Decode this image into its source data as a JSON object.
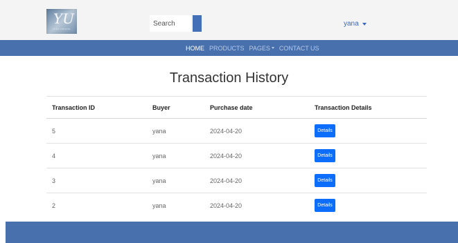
{
  "header": {
    "logo_mark": "YU",
    "logo_subtext": "YANA UNIQUE",
    "search_placeholder": "Search",
    "user_name": "yana"
  },
  "nav": {
    "items": [
      {
        "label": "HOME",
        "active": true
      },
      {
        "label": "PRODUCTS",
        "active": false
      },
      {
        "label": "PAGES",
        "active": false,
        "has_dropdown": true
      },
      {
        "label": "CONTACT US",
        "active": false
      }
    ]
  },
  "page": {
    "title": "Transaction History"
  },
  "table": {
    "headers": [
      "Transaction ID",
      "Buyer",
      "Purchase date",
      "Transaction Details"
    ],
    "rows": [
      {
        "id": "5",
        "buyer": "yana",
        "date": "2024-04-20",
        "action": "Details"
      },
      {
        "id": "4",
        "buyer": "yana",
        "date": "2024-04-20",
        "action": "Details"
      },
      {
        "id": "3",
        "buyer": "yana",
        "date": "2024-04-20",
        "action": "Details"
      },
      {
        "id": "2",
        "buyer": "yana",
        "date": "2024-04-20",
        "action": "Details"
      }
    ]
  },
  "colors": {
    "brand_blue": "#4770ad",
    "button_blue": "#0d6efd",
    "link_blue": "#3a66c0",
    "topbar_bg": "#f4f4f4"
  }
}
